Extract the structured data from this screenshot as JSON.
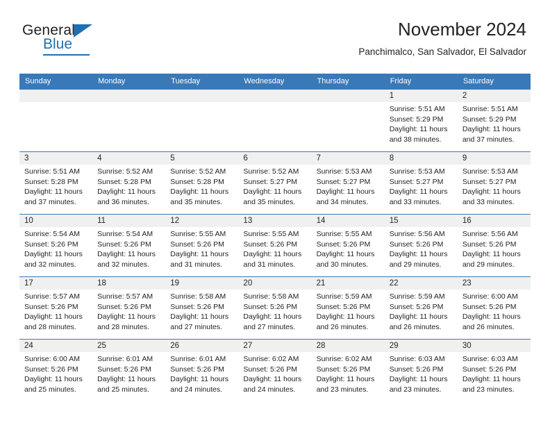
{
  "brand": {
    "word1": "General",
    "word2": "Blue",
    "accent_color": "#1f6fb2"
  },
  "header": {
    "title": "November 2024",
    "subtitle": "Panchimalco, San Salvador, El Salvador"
  },
  "calendar": {
    "header_color": "#3a79b8",
    "daynum_band_color": "#f0f0f0",
    "weekdays": [
      "Sunday",
      "Monday",
      "Tuesday",
      "Wednesday",
      "Thursday",
      "Friday",
      "Saturday"
    ],
    "labels": {
      "sunrise": "Sunrise:",
      "sunset": "Sunset:",
      "daylight": "Daylight:"
    },
    "weeks": [
      [
        {
          "day": ""
        },
        {
          "day": ""
        },
        {
          "day": ""
        },
        {
          "day": ""
        },
        {
          "day": ""
        },
        {
          "day": "1",
          "sunrise": "Sunrise: 5:51 AM",
          "sunset": "Sunset: 5:29 PM",
          "daylight": "Daylight: 11 hours and 38 minutes."
        },
        {
          "day": "2",
          "sunrise": "Sunrise: 5:51 AM",
          "sunset": "Sunset: 5:29 PM",
          "daylight": "Daylight: 11 hours and 37 minutes."
        }
      ],
      [
        {
          "day": "3",
          "sunrise": "Sunrise: 5:51 AM",
          "sunset": "Sunset: 5:28 PM",
          "daylight": "Daylight: 11 hours and 37 minutes."
        },
        {
          "day": "4",
          "sunrise": "Sunrise: 5:52 AM",
          "sunset": "Sunset: 5:28 PM",
          "daylight": "Daylight: 11 hours and 36 minutes."
        },
        {
          "day": "5",
          "sunrise": "Sunrise: 5:52 AM",
          "sunset": "Sunset: 5:28 PM",
          "daylight": "Daylight: 11 hours and 35 minutes."
        },
        {
          "day": "6",
          "sunrise": "Sunrise: 5:52 AM",
          "sunset": "Sunset: 5:27 PM",
          "daylight": "Daylight: 11 hours and 35 minutes."
        },
        {
          "day": "7",
          "sunrise": "Sunrise: 5:53 AM",
          "sunset": "Sunset: 5:27 PM",
          "daylight": "Daylight: 11 hours and 34 minutes."
        },
        {
          "day": "8",
          "sunrise": "Sunrise: 5:53 AM",
          "sunset": "Sunset: 5:27 PM",
          "daylight": "Daylight: 11 hours and 33 minutes."
        },
        {
          "day": "9",
          "sunrise": "Sunrise: 5:53 AM",
          "sunset": "Sunset: 5:27 PM",
          "daylight": "Daylight: 11 hours and 33 minutes."
        }
      ],
      [
        {
          "day": "10",
          "sunrise": "Sunrise: 5:54 AM",
          "sunset": "Sunset: 5:26 PM",
          "daylight": "Daylight: 11 hours and 32 minutes."
        },
        {
          "day": "11",
          "sunrise": "Sunrise: 5:54 AM",
          "sunset": "Sunset: 5:26 PM",
          "daylight": "Daylight: 11 hours and 32 minutes."
        },
        {
          "day": "12",
          "sunrise": "Sunrise: 5:55 AM",
          "sunset": "Sunset: 5:26 PM",
          "daylight": "Daylight: 11 hours and 31 minutes."
        },
        {
          "day": "13",
          "sunrise": "Sunrise: 5:55 AM",
          "sunset": "Sunset: 5:26 PM",
          "daylight": "Daylight: 11 hours and 31 minutes."
        },
        {
          "day": "14",
          "sunrise": "Sunrise: 5:55 AM",
          "sunset": "Sunset: 5:26 PM",
          "daylight": "Daylight: 11 hours and 30 minutes."
        },
        {
          "day": "15",
          "sunrise": "Sunrise: 5:56 AM",
          "sunset": "Sunset: 5:26 PM",
          "daylight": "Daylight: 11 hours and 29 minutes."
        },
        {
          "day": "16",
          "sunrise": "Sunrise: 5:56 AM",
          "sunset": "Sunset: 5:26 PM",
          "daylight": "Daylight: 11 hours and 29 minutes."
        }
      ],
      [
        {
          "day": "17",
          "sunrise": "Sunrise: 5:57 AM",
          "sunset": "Sunset: 5:26 PM",
          "daylight": "Daylight: 11 hours and 28 minutes."
        },
        {
          "day": "18",
          "sunrise": "Sunrise: 5:57 AM",
          "sunset": "Sunset: 5:26 PM",
          "daylight": "Daylight: 11 hours and 28 minutes."
        },
        {
          "day": "19",
          "sunrise": "Sunrise: 5:58 AM",
          "sunset": "Sunset: 5:26 PM",
          "daylight": "Daylight: 11 hours and 27 minutes."
        },
        {
          "day": "20",
          "sunrise": "Sunrise: 5:58 AM",
          "sunset": "Sunset: 5:26 PM",
          "daylight": "Daylight: 11 hours and 27 minutes."
        },
        {
          "day": "21",
          "sunrise": "Sunrise: 5:59 AM",
          "sunset": "Sunset: 5:26 PM",
          "daylight": "Daylight: 11 hours and 26 minutes."
        },
        {
          "day": "22",
          "sunrise": "Sunrise: 5:59 AM",
          "sunset": "Sunset: 5:26 PM",
          "daylight": "Daylight: 11 hours and 26 minutes."
        },
        {
          "day": "23",
          "sunrise": "Sunrise: 6:00 AM",
          "sunset": "Sunset: 5:26 PM",
          "daylight": "Daylight: 11 hours and 26 minutes."
        }
      ],
      [
        {
          "day": "24",
          "sunrise": "Sunrise: 6:00 AM",
          "sunset": "Sunset: 5:26 PM",
          "daylight": "Daylight: 11 hours and 25 minutes."
        },
        {
          "day": "25",
          "sunrise": "Sunrise: 6:01 AM",
          "sunset": "Sunset: 5:26 PM",
          "daylight": "Daylight: 11 hours and 25 minutes."
        },
        {
          "day": "26",
          "sunrise": "Sunrise: 6:01 AM",
          "sunset": "Sunset: 5:26 PM",
          "daylight": "Daylight: 11 hours and 24 minutes."
        },
        {
          "day": "27",
          "sunrise": "Sunrise: 6:02 AM",
          "sunset": "Sunset: 5:26 PM",
          "daylight": "Daylight: 11 hours and 24 minutes."
        },
        {
          "day": "28",
          "sunrise": "Sunrise: 6:02 AM",
          "sunset": "Sunset: 5:26 PM",
          "daylight": "Daylight: 11 hours and 23 minutes."
        },
        {
          "day": "29",
          "sunrise": "Sunrise: 6:03 AM",
          "sunset": "Sunset: 5:26 PM",
          "daylight": "Daylight: 11 hours and 23 minutes."
        },
        {
          "day": "30",
          "sunrise": "Sunrise: 6:03 AM",
          "sunset": "Sunset: 5:26 PM",
          "daylight": "Daylight: 11 hours and 23 minutes."
        }
      ]
    ]
  }
}
